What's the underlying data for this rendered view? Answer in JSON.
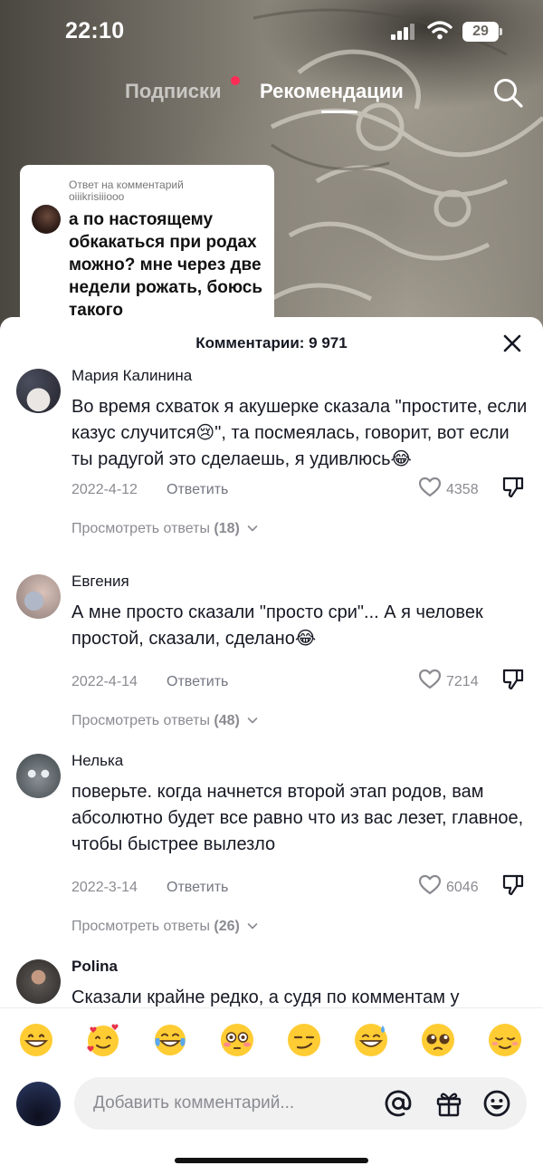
{
  "status_bar": {
    "time": "22:10",
    "battery": "29"
  },
  "top_tabs": {
    "following": "Подписки",
    "for_you": "Рекомендации"
  },
  "reply_card": {
    "caption": "Ответ на комментарий",
    "username": "oiiikrisiiiooo",
    "text": "а по настоящему обкакаться при родах можно? мне через две недели рожать, боюсь такого"
  },
  "comments_sheet": {
    "title": "Комментарии: 9 971",
    "reply_label": "Ответить",
    "comments": [
      {
        "author": "Мария Калинина",
        "text": "Во время схваток я акушерке сказала \"простите, если казус случится😢\", та посмеялась, говорит, вот если ты радугой это сделаешь, я удивлюсь😂",
        "date": "2022-4-12",
        "likes": "4358",
        "replies_label": "Просмотреть ответы",
        "replies_count": "(18)"
      },
      {
        "author": "Евгения",
        "text": "А мне просто сказали \"просто сри\"... А я человек простой, сказали, сделано😂",
        "date": "2022-4-14",
        "likes": "7214",
        "replies_label": "Просмотреть ответы",
        "replies_count": "(48)"
      },
      {
        "author": "Нелька",
        "text": "поверьте. когда начнется второй этап родов, вам абсолютно будет все равно что из вас лезет, главное, чтобы быстрее вылезло",
        "date": "2022-3-14",
        "likes": "6046",
        "replies_label": "Просмотреть ответы",
        "replies_count": "(26)"
      },
      {
        "author": "Polina",
        "text": "Сказали крайне редко, а судя по комментам у"
      }
    ]
  },
  "emoji_bar": [
    "😁",
    "🥰",
    "😂",
    "😳",
    "😏",
    "😅",
    "🥺",
    "😌"
  ],
  "input_bar": {
    "placeholder": "Добавить комментарий..."
  },
  "colors": {
    "accent_dot": "#fe2c55",
    "text_primary": "#161823",
    "text_secondary": "#8a8b91"
  }
}
